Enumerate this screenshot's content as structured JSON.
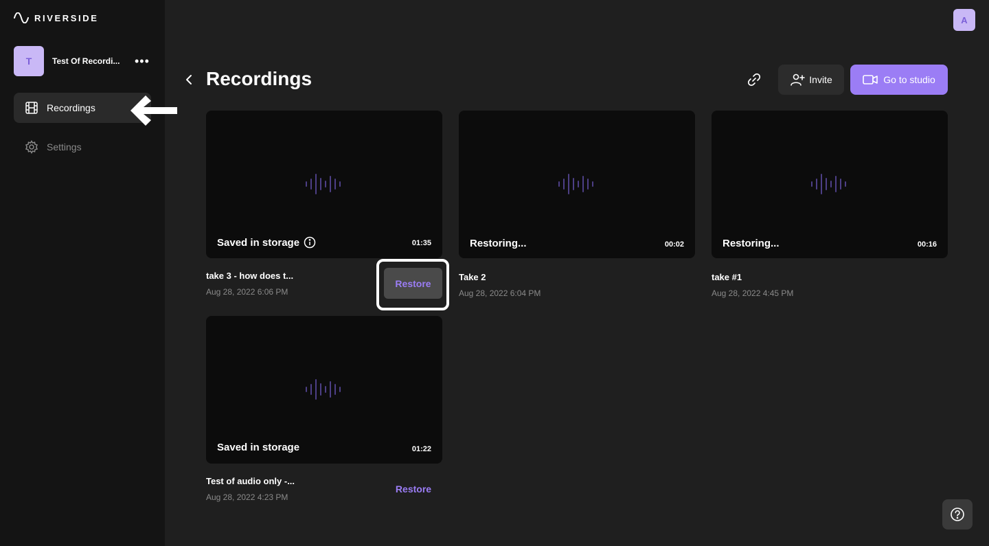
{
  "app": {
    "logo_text": "RIVERSIDE"
  },
  "workspace": {
    "avatar_letter": "T",
    "name": "Test Of Recordi..."
  },
  "sidebar": {
    "items": [
      {
        "label": "Recordings",
        "icon": "film-icon",
        "active": true
      },
      {
        "label": "Settings",
        "icon": "gear-icon",
        "active": false
      }
    ]
  },
  "user": {
    "avatar_letter": "A"
  },
  "header": {
    "title": "Recordings",
    "invite_label": "Invite",
    "studio_label": "Go to studio"
  },
  "recordings": [
    {
      "status": "Saved in storage",
      "duration": "01:35",
      "title": "take 3 - how does t...",
      "date": "Aug 28, 2022 6:06 PM",
      "action": "Restore",
      "info": true
    },
    {
      "status": "Restoring...",
      "duration": "00:02",
      "title": "Take 2",
      "date": "Aug 28, 2022 6:04 PM"
    },
    {
      "status": "Restoring...",
      "duration": "00:16",
      "title": "take #1",
      "date": "Aug 28, 2022 4:45 PM"
    },
    {
      "status": "Saved in storage",
      "duration": "01:22",
      "title": "Test of audio only -...",
      "date": "Aug 28, 2022 4:23 PM",
      "action": "Restore"
    }
  ],
  "colors": {
    "accent": "#9b7df5",
    "sidebar_bg": "#141414",
    "main_bg": "#1f1f1f",
    "thumb_bg": "#0c0c0c",
    "wave": "#4d3f86"
  }
}
